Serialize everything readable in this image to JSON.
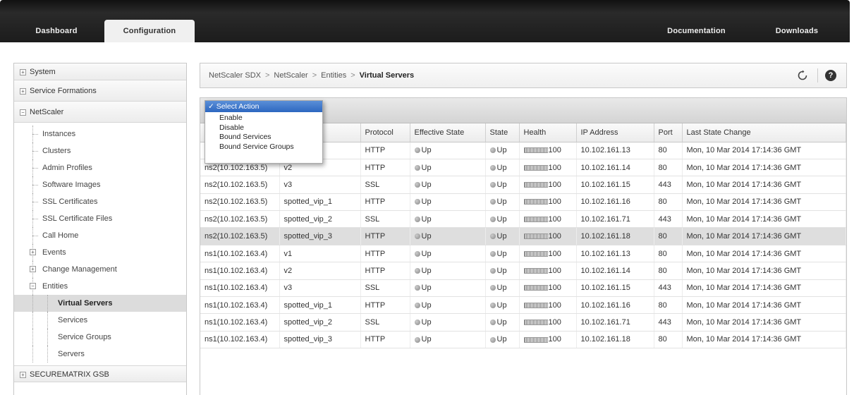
{
  "topnav": {
    "tabs": [
      "Dashboard",
      "Configuration"
    ],
    "links": [
      "Documentation",
      "Downloads"
    ]
  },
  "sidebar": {
    "sections": [
      "System",
      "Service Formations",
      "NetScaler"
    ],
    "netscaler_items": [
      "Instances",
      "Clusters",
      "Admin Profiles",
      "Software Images",
      "SSL Certificates",
      "SSL Certificate Files",
      "Call Home"
    ],
    "groups": [
      "Events",
      "Change Management",
      "Entities"
    ],
    "entities_items": [
      "Virtual Servers",
      "Services",
      "Service Groups",
      "Servers"
    ],
    "bottom_section": "SECUREMATRIX GSB",
    "selected": "Virtual Servers"
  },
  "breadcrumb": {
    "items": [
      "NetScaler SDX",
      "NetScaler",
      "Entities"
    ],
    "current": "Virtual Servers",
    "separator": ">"
  },
  "action_menu": {
    "selected": "✓ Select Action",
    "options": [
      "Enable",
      "Disable",
      "Bound Services",
      "Bound Service Groups"
    ]
  },
  "table": {
    "headers": [
      "Protocol",
      "Effective State",
      "State",
      "Health",
      "IP Address",
      "Port",
      "Last State Change"
    ],
    "rows": [
      [
        "",
        "",
        "HTTP",
        "Up",
        "Up",
        "100",
        "10.102.161.13",
        "80",
        "Mon, 10 Mar 2014 17:14:36 GMT"
      ],
      [
        "ns2(10.102.163.5)",
        "v2",
        "HTTP",
        "Up",
        "Up",
        "100",
        "10.102.161.14",
        "80",
        "Mon, 10 Mar 2014 17:14:36 GMT"
      ],
      [
        "ns2(10.102.163.5)",
        "v3",
        "SSL",
        "Up",
        "Up",
        "100",
        "10.102.161.15",
        "443",
        "Mon, 10 Mar 2014 17:14:36 GMT"
      ],
      [
        "ns2(10.102.163.5)",
        "spotted_vip_1",
        "HTTP",
        "Up",
        "Up",
        "100",
        "10.102.161.16",
        "80",
        "Mon, 10 Mar 2014 17:14:36 GMT"
      ],
      [
        "ns2(10.102.163.5)",
        "spotted_vip_2",
        "SSL",
        "Up",
        "Up",
        "100",
        "10.102.161.71",
        "443",
        "Mon, 10 Mar 2014 17:14:36 GMT"
      ],
      [
        "ns2(10.102.163.5)",
        "spotted_vip_3",
        "HTTP",
        "Up",
        "Up",
        "100",
        "10.102.161.18",
        "80",
        "Mon, 10 Mar 2014 17:14:36 GMT"
      ],
      [
        "ns1(10.102.163.4)",
        "v1",
        "HTTP",
        "Up",
        "Up",
        "100",
        "10.102.161.13",
        "80",
        "Mon, 10 Mar 2014 17:14:36 GMT"
      ],
      [
        "ns1(10.102.163.4)",
        "v2",
        "HTTP",
        "Up",
        "Up",
        "100",
        "10.102.161.14",
        "80",
        "Mon, 10 Mar 2014 17:14:36 GMT"
      ],
      [
        "ns1(10.102.163.4)",
        "v3",
        "SSL",
        "Up",
        "Up",
        "100",
        "10.102.161.15",
        "443",
        "Mon, 10 Mar 2014 17:14:36 GMT"
      ],
      [
        "ns1(10.102.163.4)",
        "spotted_vip_1",
        "HTTP",
        "Up",
        "Up",
        "100",
        "10.102.161.16",
        "80",
        "Mon, 10 Mar 2014 17:14:36 GMT"
      ],
      [
        "ns1(10.102.163.4)",
        "spotted_vip_2",
        "SSL",
        "Up",
        "Up",
        "100",
        "10.102.161.71",
        "443",
        "Mon, 10 Mar 2014 17:14:36 GMT"
      ],
      [
        "ns1(10.102.163.4)",
        "spotted_vip_3",
        "HTTP",
        "Up",
        "Up",
        "100",
        "10.102.161.18",
        "80",
        "Mon, 10 Mar 2014 17:14:36 GMT"
      ]
    ],
    "selected_row_index": 5
  },
  "icons": {
    "refresh": "refresh-icon",
    "help": "help-icon"
  }
}
